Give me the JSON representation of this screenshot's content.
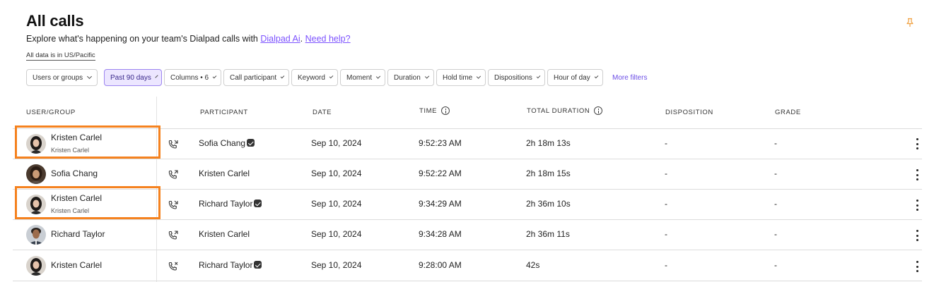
{
  "page": {
    "title": "All calls",
    "subtitle_prefix": "Explore what's happening on your team's Dialpad calls with",
    "link_ai": "Dialpad Ai",
    "subtitle_sep": ".",
    "link_help": "Need help?",
    "timezone_note": "All data is in US/Pacific"
  },
  "filters": {
    "users_or_groups": "Users or groups",
    "date_range": "Past 90 days",
    "columns": "Columns • 6",
    "call_participant": "Call participant",
    "keyword": "Keyword",
    "moment": "Moment",
    "duration": "Duration",
    "hold_time": "Hold time",
    "dispositions": "Dispositions",
    "hour_of_day": "Hour of day",
    "more_filters": "More filters"
  },
  "table": {
    "headers": {
      "user_group": "USER/GROUP",
      "participant": "PARTICIPANT",
      "date": "DATE",
      "time": "TIME",
      "total_duration": "TOTAL DURATION",
      "disposition": "DISPOSITION",
      "grade": "GRADE"
    },
    "rows": [
      {
        "user": "Kristen Carlel",
        "user_sub": "Kristen Carlel",
        "call_icon": "outgoing-call-icon",
        "participant": "Sofia Chang",
        "date": "Sep 10, 2024",
        "time": "9:52:23 AM",
        "duration": "2h 18m 13s",
        "disposition": "-",
        "grade": "-"
      },
      {
        "user": "Sofia Chang",
        "user_sub": "",
        "call_icon": "incoming-call-icon",
        "participant": "Kristen Carlel",
        "date": "Sep 10, 2024",
        "time": "9:52:22 AM",
        "duration": "2h 18m 15s",
        "disposition": "-",
        "grade": "-"
      },
      {
        "user": "Kristen Carlel",
        "user_sub": "Kristen Carlel",
        "call_icon": "outgoing-call-icon",
        "participant": "Richard Taylor",
        "date": "Sep 10, 2024",
        "time": "9:34:29 AM",
        "duration": "2h 36m 10s",
        "disposition": "-",
        "grade": "-"
      },
      {
        "user": "Richard Taylor",
        "user_sub": "",
        "call_icon": "incoming-call-icon",
        "participant": "Kristen Carlel",
        "date": "Sep 10, 2024",
        "time": "9:34:28 AM",
        "duration": "2h 36m 11s",
        "disposition": "-",
        "grade": "-"
      },
      {
        "user": "Kristen Carlel",
        "user_sub": "",
        "call_icon": "missed-call-icon",
        "participant": "Richard Taylor",
        "date": "Sep 10, 2024",
        "time": "9:28:00 AM",
        "duration": "42s",
        "disposition": "-",
        "grade": "-"
      }
    ]
  },
  "colors": {
    "accent": "#7c52ff",
    "highlight": "#f5821f",
    "active_chip_bg": "#ece6ff"
  }
}
